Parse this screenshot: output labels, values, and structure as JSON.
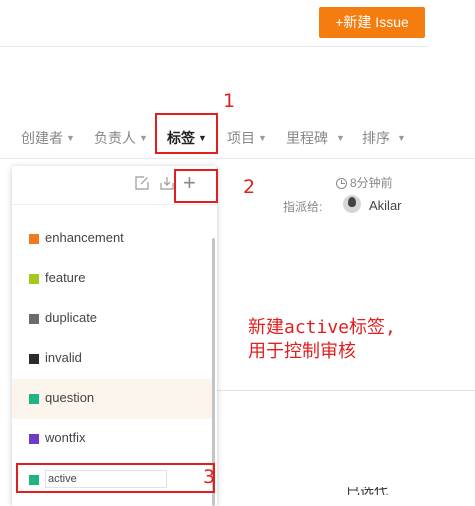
{
  "header": {
    "new_issue_label": "+新建 Issue",
    "new_issue_color": "#f57c0e"
  },
  "filters": [
    {
      "label": "创建者",
      "active": false
    },
    {
      "label": "负责人",
      "active": false
    },
    {
      "label": "标签",
      "active": true
    },
    {
      "label": "项目",
      "active": false
    },
    {
      "label": "里程碑",
      "active": false
    },
    {
      "label": "排序",
      "active": false
    }
  ],
  "issue_meta": {
    "time": "8分钟前",
    "assignee_label": "指派给:",
    "assignee_name": "Akilar"
  },
  "label_dropdown": {
    "items": [
      {
        "name": "enhancement",
        "color": "#f07a22"
      },
      {
        "name": "feature",
        "color": "#a4c91e"
      },
      {
        "name": "duplicate",
        "color": "#6b6b6b"
      },
      {
        "name": "invalid",
        "color": "#2b2b2b"
      },
      {
        "name": "question",
        "color": "#1fb484"
      },
      {
        "name": "wontfix",
        "color": "#6d3bc9"
      }
    ],
    "new_label": {
      "value": "active",
      "color": "#1fb484"
    }
  },
  "annotations": {
    "step1": "1",
    "step2": "2",
    "step3": "3",
    "note_line1": "新建active标签,",
    "note_line2": "用于控制审核",
    "color": "#e02020"
  },
  "bottom_fragment": "已选代码"
}
